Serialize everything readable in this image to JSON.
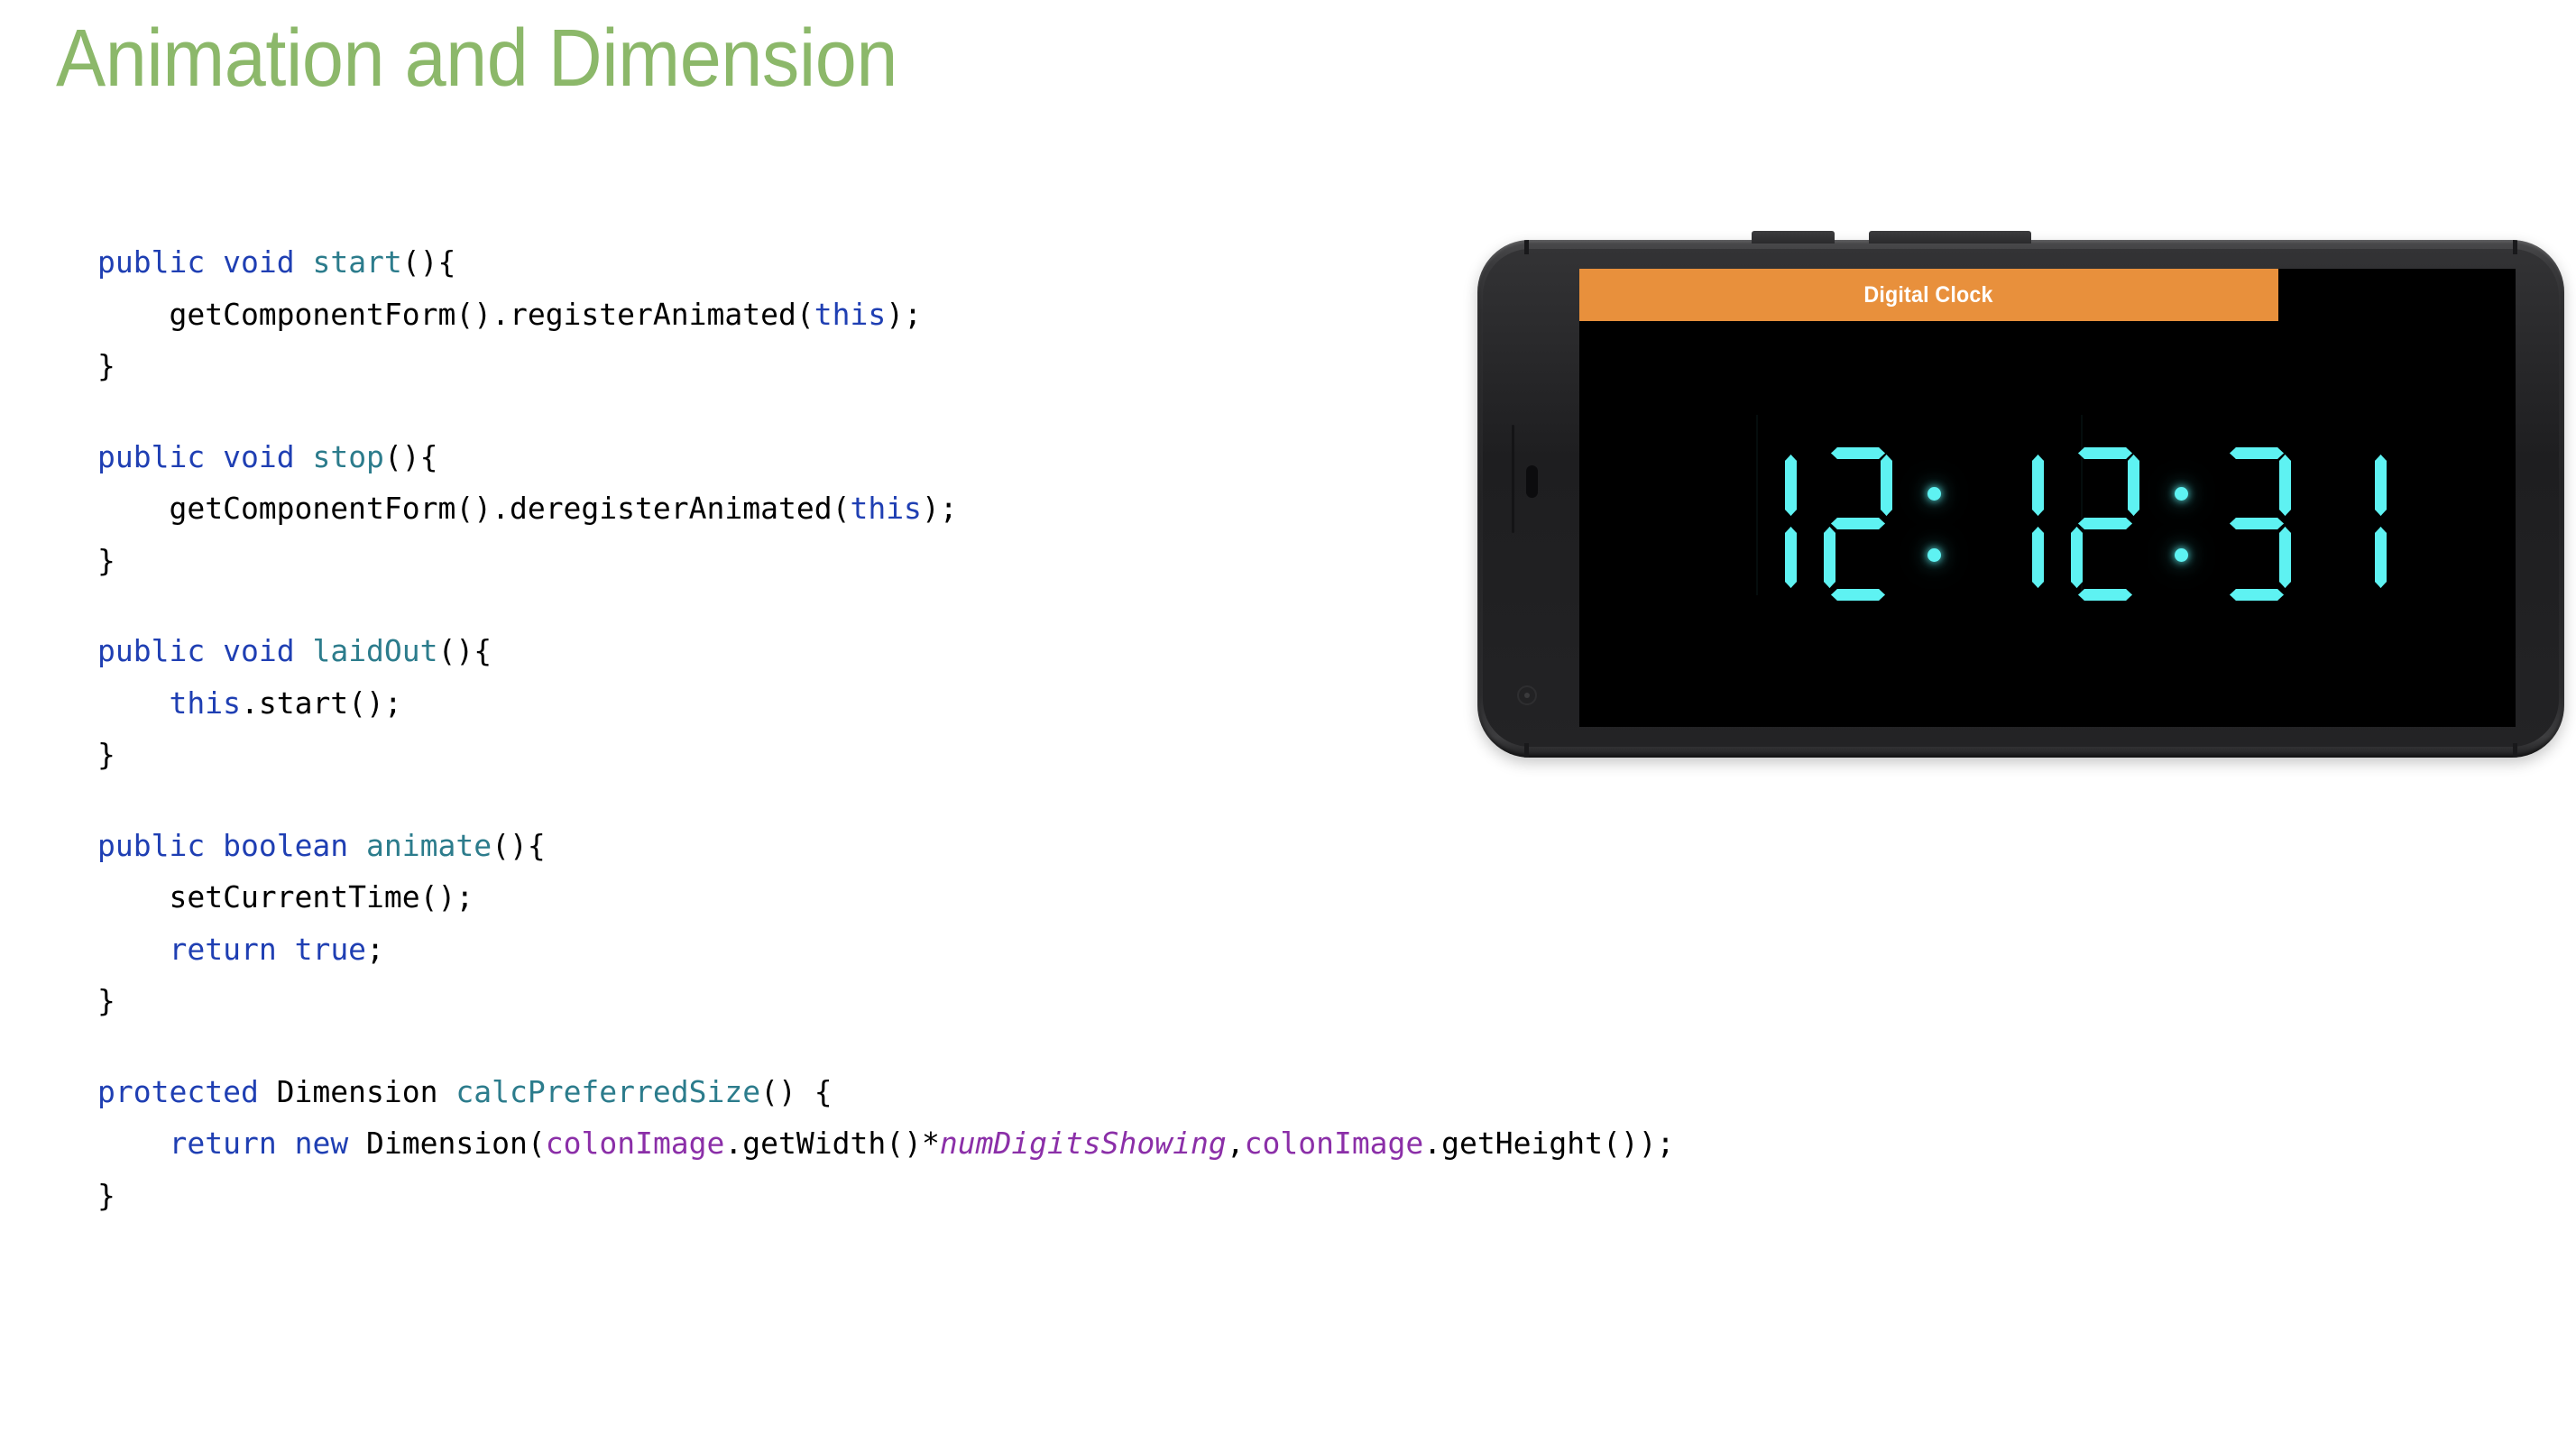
{
  "slide": {
    "title": "Animation and Dimension",
    "title_color": "#8CB86A",
    "background_color": "#FFFFFF"
  },
  "code": {
    "language": "java",
    "colors": {
      "keyword": "#1F3FB3",
      "method": "#2C7C8C",
      "variable": "#8B2FA8",
      "plain": "#000000"
    },
    "blocks": [
      {
        "name": "start-method",
        "lines": [
          [
            {
              "t": "public",
              "c": "keyword"
            },
            {
              "t": " ",
              "c": "plain"
            },
            {
              "t": "void",
              "c": "keyword"
            },
            {
              "t": " ",
              "c": "plain"
            },
            {
              "t": "start",
              "c": "method"
            },
            {
              "t": "(){",
              "c": "plain"
            }
          ],
          [
            {
              "t": "    getComponentForm().registerAnimated(",
              "c": "plain"
            },
            {
              "t": "this",
              "c": "keyword"
            },
            {
              "t": ");",
              "c": "plain"
            }
          ],
          [
            {
              "t": "}",
              "c": "plain"
            }
          ]
        ]
      },
      {
        "name": "stop-method",
        "lines": [
          [
            {
              "t": "public",
              "c": "keyword"
            },
            {
              "t": " ",
              "c": "plain"
            },
            {
              "t": "void",
              "c": "keyword"
            },
            {
              "t": " ",
              "c": "plain"
            },
            {
              "t": "stop",
              "c": "method"
            },
            {
              "t": "(){",
              "c": "plain"
            }
          ],
          [
            {
              "t": "    getComponentForm().deregisterAnimated(",
              "c": "plain"
            },
            {
              "t": "this",
              "c": "keyword"
            },
            {
              "t": ");",
              "c": "plain"
            }
          ],
          [
            {
              "t": "}",
              "c": "plain"
            }
          ]
        ]
      },
      {
        "name": "laidout-method",
        "lines": [
          [
            {
              "t": "public",
              "c": "keyword"
            },
            {
              "t": " ",
              "c": "plain"
            },
            {
              "t": "void",
              "c": "keyword"
            },
            {
              "t": " ",
              "c": "plain"
            },
            {
              "t": "laidOut",
              "c": "method"
            },
            {
              "t": "(){",
              "c": "plain"
            }
          ],
          [
            {
              "t": "    ",
              "c": "plain"
            },
            {
              "t": "this",
              "c": "keyword"
            },
            {
              "t": ".start();",
              "c": "plain"
            }
          ],
          [
            {
              "t": "}",
              "c": "plain"
            }
          ]
        ]
      },
      {
        "name": "animate-method",
        "lines": [
          [
            {
              "t": "public",
              "c": "keyword"
            },
            {
              "t": " ",
              "c": "plain"
            },
            {
              "t": "boolean",
              "c": "keyword"
            },
            {
              "t": " ",
              "c": "plain"
            },
            {
              "t": "animate",
              "c": "method"
            },
            {
              "t": "(){",
              "c": "plain"
            }
          ],
          [
            {
              "t": "    setCurrentTime();",
              "c": "plain"
            }
          ],
          [
            {
              "t": "    ",
              "c": "plain"
            },
            {
              "t": "return",
              "c": "keyword"
            },
            {
              "t": " ",
              "c": "plain"
            },
            {
              "t": "true",
              "c": "keyword"
            },
            {
              "t": ";",
              "c": "plain"
            }
          ],
          [
            {
              "t": "}",
              "c": "plain"
            }
          ]
        ]
      },
      {
        "name": "calcpreferredsize-method",
        "lines": [
          [
            {
              "t": "protected",
              "c": "keyword"
            },
            {
              "t": " Dimension ",
              "c": "plain"
            },
            {
              "t": "calcPreferredSize",
              "c": "method"
            },
            {
              "t": "() {",
              "c": "plain"
            }
          ],
          [
            {
              "t": "    ",
              "c": "plain"
            },
            {
              "t": "return",
              "c": "keyword"
            },
            {
              "t": " ",
              "c": "plain"
            },
            {
              "t": "new",
              "c": "keyword"
            },
            {
              "t": " Dimension(",
              "c": "plain"
            },
            {
              "t": "colonImage",
              "c": "variable"
            },
            {
              "t": ".getWidth()*",
              "c": "plain"
            },
            {
              "t": "numDigitsShowing",
              "c": "variable-italic"
            },
            {
              "t": ",",
              "c": "plain"
            },
            {
              "t": "colonImage",
              "c": "variable"
            },
            {
              "t": ".getHeight());",
              "c": "plain"
            }
          ],
          [
            {
              "t": "}",
              "c": "plain"
            }
          ]
        ]
      }
    ]
  },
  "phone": {
    "orientation": "landscape",
    "body_color": "#2A2A2C",
    "app": {
      "titlebar": {
        "label": "Digital Clock",
        "background_color": "#E8903C",
        "text_color": "#FFFFFF"
      },
      "screen_background": "#000000",
      "clock": {
        "display_text": "12:12:31",
        "segment_color": "#5EF2F2",
        "hours": "12",
        "minutes": "12",
        "seconds": "31",
        "cells": [
          {
            "type": "digit",
            "value": "1"
          },
          {
            "type": "digit",
            "value": "2"
          },
          {
            "type": "colon",
            "value": ":"
          },
          {
            "type": "digit",
            "value": "1"
          },
          {
            "type": "digit",
            "value": "2"
          },
          {
            "type": "colon",
            "value": ":"
          },
          {
            "type": "digit",
            "value": "3"
          },
          {
            "type": "digit",
            "value": "1"
          }
        ]
      }
    }
  }
}
